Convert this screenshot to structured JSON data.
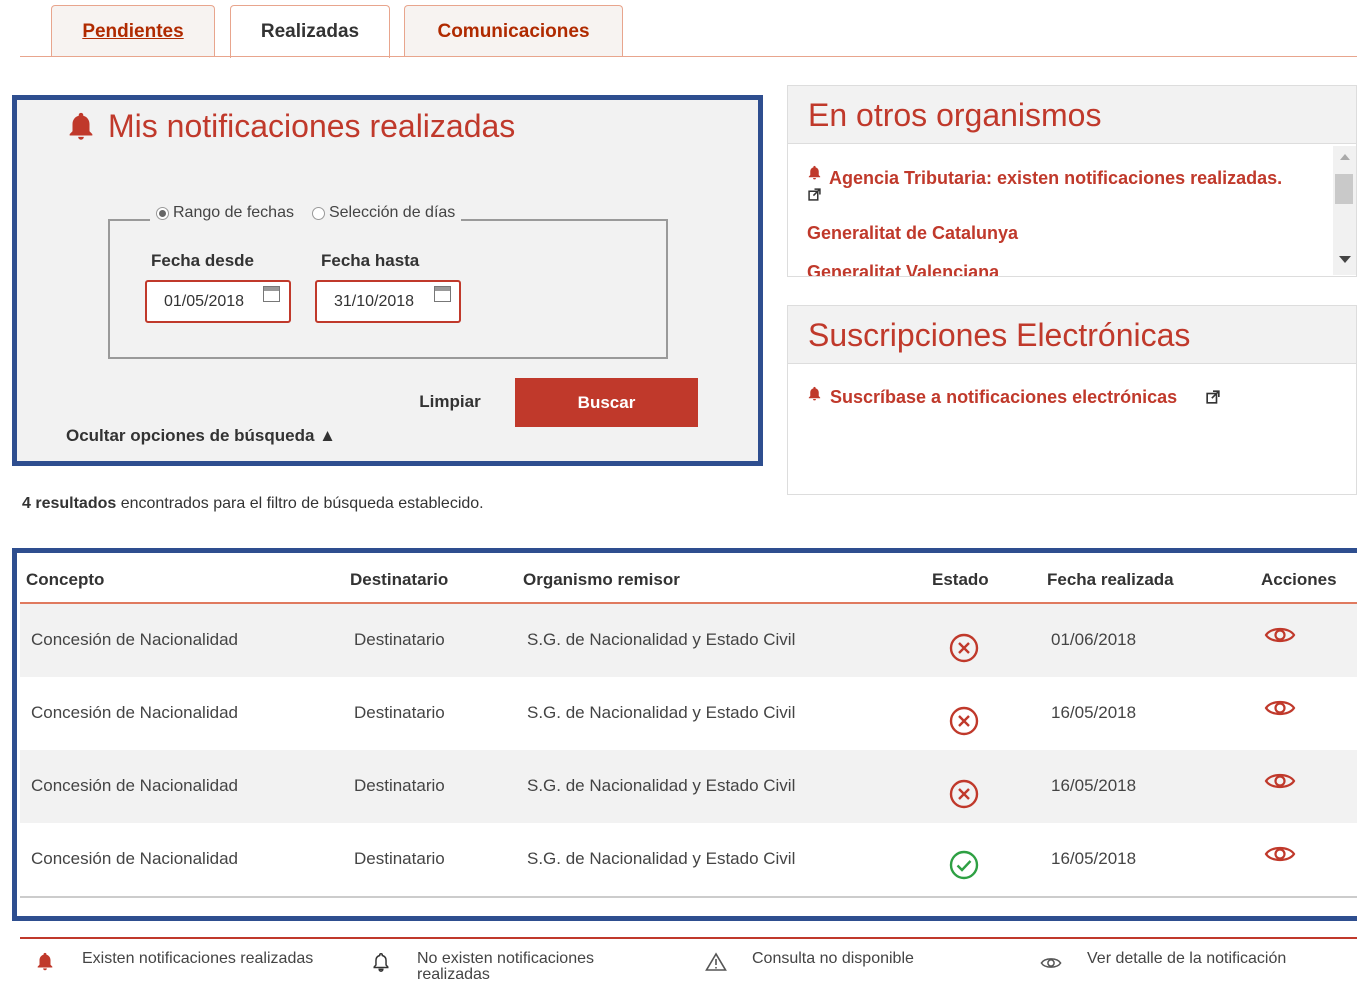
{
  "tabs": [
    {
      "label": "Pendientes"
    },
    {
      "label": "Realizadas"
    },
    {
      "label": "Comunicaciones"
    }
  ],
  "search": {
    "title": "Mis notificaciones realizadas",
    "radio_range": "Rango de fechas",
    "radio_days": "Selección de días",
    "from_label": "Fecha desde",
    "to_label": "Fecha hasta",
    "from_value": "01/05/2018",
    "to_value": "31/10/2018",
    "clear_label": "Limpiar",
    "search_label": "Buscar",
    "toggle_label": "Ocultar opciones de búsqueda ▲"
  },
  "other_orgs": {
    "title": "En otros organismos",
    "items": [
      "Agencia Tributaria: existen notificaciones realizadas.",
      "Generalitat de Catalunya",
      "Generalitat Valenciana"
    ]
  },
  "subscriptions": {
    "title": "Suscripciones Electrónicas",
    "link": "Suscríbase a notificaciones electrónicas"
  },
  "results": {
    "count": "4 resultados",
    "suffix": " encontrados para el filtro de búsqueda establecido."
  },
  "table": {
    "headers": [
      "Concepto",
      "Destinatario",
      "Organismo remisor",
      "Estado",
      "Fecha realizada",
      "Acciones"
    ],
    "rows": [
      {
        "concepto": "Concesión de Nacionalidad",
        "destinatario": "Destinatario",
        "organismo": "S.G. de Nacionalidad y Estado Civil",
        "estado": "rejected",
        "fecha": "01/06/2018"
      },
      {
        "concepto": "Concesión de Nacionalidad",
        "destinatario": "Destinatario",
        "organismo": "S.G. de Nacionalidad y Estado Civil",
        "estado": "rejected",
        "fecha": "16/05/2018"
      },
      {
        "concepto": "Concesión de Nacionalidad",
        "destinatario": "Destinatario",
        "organismo": "S.G. de Nacionalidad y Estado Civil",
        "estado": "rejected",
        "fecha": "16/05/2018"
      },
      {
        "concepto": "Concesión de Nacionalidad",
        "destinatario": "Destinatario",
        "organismo": "S.G. de Nacionalidad y Estado Civil",
        "estado": "accepted",
        "fecha": "16/05/2018"
      }
    ]
  },
  "legend": {
    "existen": "Existen notificaciones realizadas",
    "no_existen": "No existen notificaciones realizadas",
    "no_disponible": "Consulta no disponible",
    "ver_detalle": "Ver detalle de la notificación"
  },
  "colors": {
    "accent": "#c0392b",
    "frame": "#2e4e8f",
    "ok": "#2ea043"
  }
}
